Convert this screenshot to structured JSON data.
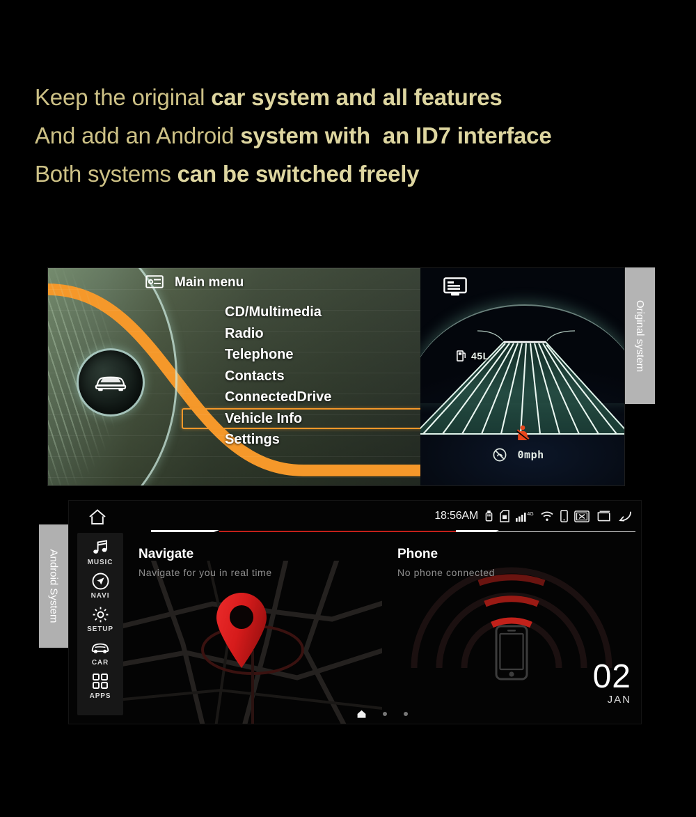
{
  "headline": {
    "line1_a": "Keep the original ",
    "line1_b": "car system and all features",
    "line2_a": "And add an Android ",
    "line2_b": "system with  an ID7 interface",
    "line3_a": "Both systems ",
    "line3_b": "can be switched freely",
    "color": "#cdc186"
  },
  "original_system": {
    "tab_label": "Original system",
    "menu_title": "Main menu",
    "menu_items": [
      {
        "label": "CD/Multimedia",
        "selected": false
      },
      {
        "label": "Radio",
        "selected": false
      },
      {
        "label": "Telephone",
        "selected": false
      },
      {
        "label": "Contacts",
        "selected": false
      },
      {
        "label": "ConnectedDrive",
        "selected": false
      },
      {
        "label": "Vehicle Info",
        "selected": true
      },
      {
        "label": "Settings",
        "selected": false
      }
    ],
    "selection_color": "#f5982a",
    "right_panel": {
      "fuel_range": "45L",
      "speed": "0mph",
      "monitor_icon": "display-icon",
      "fuel_icon": "fuel-pump-icon",
      "seatbelt_icon": "seatbelt-warning-icon",
      "speed_icon": "cruise-off-icon",
      "warning_color": "#e8471c"
    }
  },
  "android_system": {
    "tab_label": "Android System",
    "statusbar": {
      "time": "18:56AM",
      "network_label": "4G",
      "icons": [
        "usb-icon",
        "sd-card-icon",
        "signal-bars-icon",
        "wifi-icon",
        "phone-icon",
        "no-signal-box-icon",
        "recents-icon",
        "back-icon"
      ]
    },
    "home_icon": "home-icon",
    "accent_color": "#c32019",
    "sidebar": [
      {
        "label": "MUSIC",
        "icon": "music-note-icon"
      },
      {
        "label": "NAVI",
        "icon": "navigation-compass-icon"
      },
      {
        "label": "SETUP",
        "icon": "gear-icon"
      },
      {
        "label": "CAR",
        "icon": "car-icon"
      },
      {
        "label": "APPS",
        "icon": "apps-grid-icon"
      }
    ],
    "cards": [
      {
        "title": "Navigate",
        "subtitle": "Navigate for you in real time",
        "icon": "map-pin-icon"
      },
      {
        "title": "Phone",
        "subtitle": "No phone connected",
        "icon": "phone-outline-icon",
        "date_day": "02",
        "date_month": "JAN"
      }
    ],
    "pager": {
      "home_glyph": "home-icon",
      "dots": 2,
      "active_index": 0
    }
  }
}
